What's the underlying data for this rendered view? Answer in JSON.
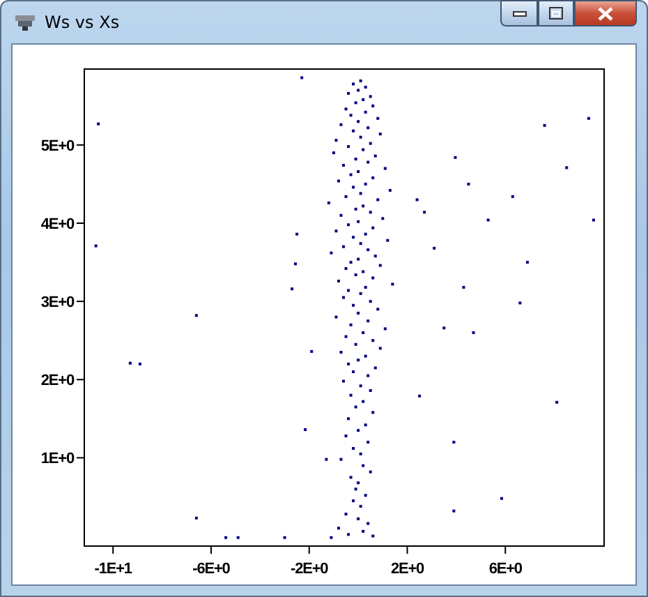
{
  "window": {
    "title": "Ws vs Xs"
  },
  "chart_data": {
    "type": "scatter",
    "xlim": [
      -11.2,
      10.0
    ],
    "ylim": [
      -0.12,
      5.98
    ],
    "xticks": [
      {
        "value": -10,
        "label": "-1E+1"
      },
      {
        "value": -6,
        "label": "-6E+0"
      },
      {
        "value": -2,
        "label": "-2E+0"
      },
      {
        "value": 2,
        "label": "2E+0"
      },
      {
        "value": 6,
        "label": "6E+0"
      }
    ],
    "yticks": [
      {
        "value": 1,
        "label": "1E+0"
      },
      {
        "value": 2,
        "label": "2E+0"
      },
      {
        "value": 3,
        "label": "3E+0"
      },
      {
        "value": 4,
        "label": "4E+0"
      },
      {
        "value": 5,
        "label": "5E+0"
      }
    ],
    "x": [
      0.1,
      -0.2,
      0.3,
      0.0,
      -0.4,
      0.5,
      0.2,
      -0.1,
      0.6,
      -0.5,
      0.3,
      -0.3,
      0.8,
      0.0,
      -0.7,
      0.4,
      -0.2,
      0.9,
      0.1,
      -0.9,
      0.5,
      -0.4,
      0.2,
      -1.0,
      0.7,
      -0.1,
      0.4,
      -0.6,
      1.1,
      0.0,
      -0.3,
      0.6,
      -0.8,
      0.3,
      -0.2,
      1.3,
      0.1,
      -0.5,
      0.8,
      -1.2,
      0.2,
      -0.1,
      0.5,
      -0.7,
      1.0,
      0.0,
      -0.4,
      0.6,
      -0.9,
      0.3,
      -0.2,
      1.2,
      0.1,
      -0.6,
      0.4,
      -1.1,
      0.7,
      0.0,
      -0.3,
      0.9,
      -0.5,
      0.2,
      -0.1,
      0.6,
      -0.8,
      1.4,
      0.3,
      -0.4,
      0.1,
      -0.6,
      0.5,
      -0.2,
      0.8,
      0.0,
      -0.9,
      0.4,
      -0.3,
      1.1,
      0.2,
      -0.5,
      0.6,
      -0.1,
      0.9,
      -0.7,
      0.3,
      0.0,
      -0.4,
      0.7,
      -0.2,
      0.4,
      -0.6,
      0.1,
      0.5,
      -0.3,
      0.2,
      -0.1,
      0.6,
      -0.4,
      0.3,
      0.0,
      -0.5,
      0.4,
      -0.2,
      0.1,
      -0.7,
      0.2,
      0.5,
      -0.3,
      0.0,
      -0.1,
      0.3,
      -0.2,
      0.1,
      -0.5,
      0.0,
      0.4,
      -0.8,
      0.2,
      -0.4,
      0.6,
      -1.1,
      -10.6,
      -10.7,
      -9.3,
      -8.9,
      -6.6,
      -6.6,
      -5.4,
      -4.9,
      -3.0,
      -2.3,
      -2.7,
      -2.56,
      -2.5,
      -1.9,
      -2.16,
      -1.3,
      2.4,
      2.5,
      2.7,
      3.1,
      3.5,
      3.9,
      3.9,
      3.96,
      4.3,
      4.5,
      4.7,
      5.3,
      5.85,
      6.3,
      6.6,
      6.9,
      7.6,
      8.1,
      8.5,
      9.4,
      9.6
    ],
    "series": [
      {
        "color": "#000080",
        "values": [
          5.82,
          5.78,
          5.74,
          5.7,
          5.66,
          5.62,
          5.58,
          5.54,
          5.5,
          5.46,
          5.42,
          5.38,
          5.34,
          5.3,
          5.26,
          5.22,
          5.18,
          5.14,
          5.1,
          5.06,
          5.02,
          4.98,
          4.94,
          4.9,
          4.86,
          4.82,
          4.78,
          4.74,
          4.7,
          4.66,
          4.62,
          4.58,
          4.54,
          4.5,
          4.46,
          4.42,
          4.38,
          4.34,
          4.3,
          4.26,
          4.22,
          4.18,
          4.14,
          4.1,
          4.06,
          4.02,
          3.98,
          3.94,
          3.9,
          3.86,
          3.82,
          3.78,
          3.74,
          3.7,
          3.66,
          3.62,
          3.58,
          3.54,
          3.5,
          3.46,
          3.42,
          3.38,
          3.34,
          3.3,
          3.26,
          3.22,
          3.18,
          3.14,
          3.1,
          3.05,
          3.0,
          2.95,
          2.9,
          2.85,
          2.8,
          2.75,
          2.7,
          2.65,
          2.6,
          2.55,
          2.5,
          2.45,
          2.4,
          2.35,
          2.3,
          2.25,
          2.2,
          2.15,
          2.1,
          2.05,
          1.98,
          1.92,
          1.86,
          1.8,
          1.72,
          1.65,
          1.58,
          1.5,
          1.42,
          1.35,
          1.28,
          1.2,
          1.12,
          1.05,
          0.98,
          0.9,
          0.82,
          0.75,
          0.68,
          0.6,
          0.52,
          0.45,
          0.38,
          0.28,
          0.22,
          0.16,
          0.1,
          0.06,
          0.02,
          0.0,
          -0.02,
          5.27,
          3.71,
          2.21,
          2.2,
          2.82,
          0.23,
          -0.02,
          -0.02,
          -0.02,
          5.86,
          3.16,
          3.48,
          3.86,
          2.36,
          1.36,
          0.98,
          4.3,
          1.79,
          4.14,
          3.68,
          2.66,
          0.32,
          1.2,
          4.84,
          3.18,
          4.5,
          2.6,
          4.04,
          0.48,
          4.34,
          2.98,
          3.5,
          5.25,
          1.71,
          4.71,
          5.34,
          4.04
        ]
      }
    ]
  }
}
